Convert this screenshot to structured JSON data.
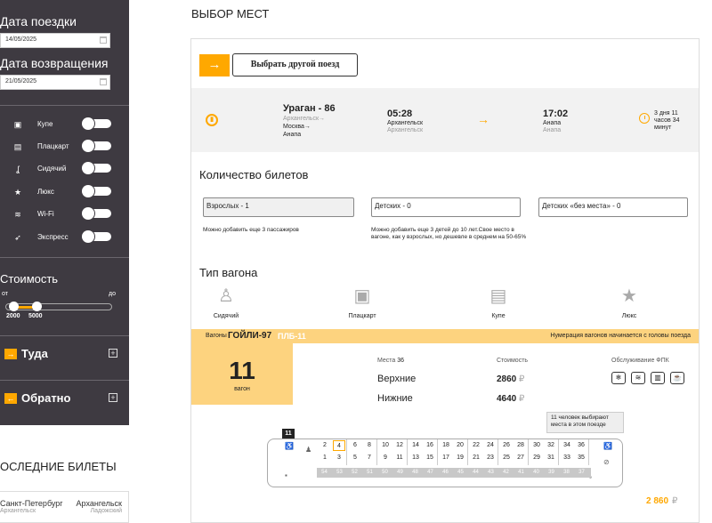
{
  "sidebar": {
    "trip_date_label": "Дата поездки",
    "trip_date_value": "14/05/2025",
    "return_date_label": "Дата возвращения",
    "return_date_value": "21/05/2025",
    "options": [
      {
        "label": "Купе",
        "icon": "compartment-icon",
        "on": false
      },
      {
        "label": "Плацкарт",
        "icon": "berth-icon",
        "on": false
      },
      {
        "label": "Сидячий",
        "icon": "seat-icon",
        "on": false
      },
      {
        "label": "Люкс",
        "icon": "star-icon",
        "on": false
      },
      {
        "label": "Wi-Fi",
        "icon": "wifi-icon",
        "on": false
      },
      {
        "label": "Экспресс",
        "icon": "rocket-icon",
        "on": false
      }
    ],
    "price_label": "Стоимость",
    "price_from_label": "от",
    "price_to_label": "до",
    "price_min": "2000",
    "price_max": "5000",
    "direction_there": "Туда",
    "direction_back": "Обратно",
    "last_tickets_title": "ОСЛЕДНИЕ БИЛЕТЫ",
    "last_ticket": {
      "from_city": "Санкт-Петербург",
      "from_station": "Архангельск",
      "to_city": "Архангельск",
      "to_station": "Ладожский"
    }
  },
  "page_title": "ВЫБОР МЕСТ",
  "choose_train_label": "Выбрать другой поезд",
  "train": {
    "name": "Ураган - 86",
    "from": "Архангельск→",
    "via": "Москва→",
    "to": "Анапа",
    "dep_time": "05:28",
    "dep_station": "Архангельск",
    "dep_station2": "Архангельск",
    "arr_time": "17:02",
    "arr_station": "Анапа",
    "arr_station2": "Анапа",
    "duration": "3 дня 11 часов 34 минут"
  },
  "tickets": {
    "title": "Количество билетов",
    "adults": "Взрослых - 1",
    "children": "Детских - 0",
    "children_no_seat": "Детских «без места» - 0",
    "adults_note": "Можно добавить еще 3 пассажиров",
    "children_note": "Можно добавить еще 3 детей до 10 лет.Свое место в вагоне, как у взрослых, но дешевле в среднем на 50-65%"
  },
  "wagon_types": {
    "title": "Тип вагона",
    "items": [
      {
        "label": "Сидячий",
        "icon": "seat-icon"
      },
      {
        "label": "Плацкарт",
        "icon": "berth-icon"
      },
      {
        "label": "Купе",
        "icon": "compartment-icon"
      },
      {
        "label": "Люкс",
        "icon": "star-icon"
      }
    ]
  },
  "wagon_bar": {
    "prefix": "Вагоны",
    "name": "ГОЙЛИ-97",
    "sub": "ПЛБ-11",
    "note": "Нумерация вагонов начинается с головы поезда"
  },
  "wagon": {
    "number": "11",
    "number_label": "вагон",
    "seats_label": "Места",
    "seats_count": "36",
    "cost_label": "Стоимость",
    "fpk_label": "Обслуживание ФПК",
    "upper_label": "Верхние",
    "lower_label": "Нижние",
    "upper_price": "2860",
    "lower_price": "4640",
    "currency": "₽",
    "tooltip": "11 человек выбирают места в этом поезде",
    "car_tag": "11",
    "upper_seats": [
      "2",
      "4",
      "6",
      "8",
      "10",
      "12",
      "14",
      "16",
      "18",
      "20",
      "22",
      "24",
      "26",
      "28",
      "30",
      "32",
      "34",
      "36"
    ],
    "lower_seats": [
      "1",
      "3",
      "5",
      "7",
      "9",
      "11",
      "13",
      "15",
      "17",
      "19",
      "21",
      "23",
      "25",
      "27",
      "29",
      "31",
      "33",
      "35"
    ],
    "side_seats": [
      "54",
      "53",
      "52",
      "51",
      "50",
      "49",
      "48",
      "47",
      "46",
      "45",
      "44",
      "43",
      "42",
      "41",
      "40",
      "39",
      "38",
      "37"
    ],
    "selected_seat": "4"
  },
  "total": {
    "value": "2 860",
    "currency": "₽"
  },
  "colors": {
    "accent": "#ffa800",
    "sidebar_bg": "#3e3a41",
    "wagon_bar_bg": "#fdd37f"
  }
}
